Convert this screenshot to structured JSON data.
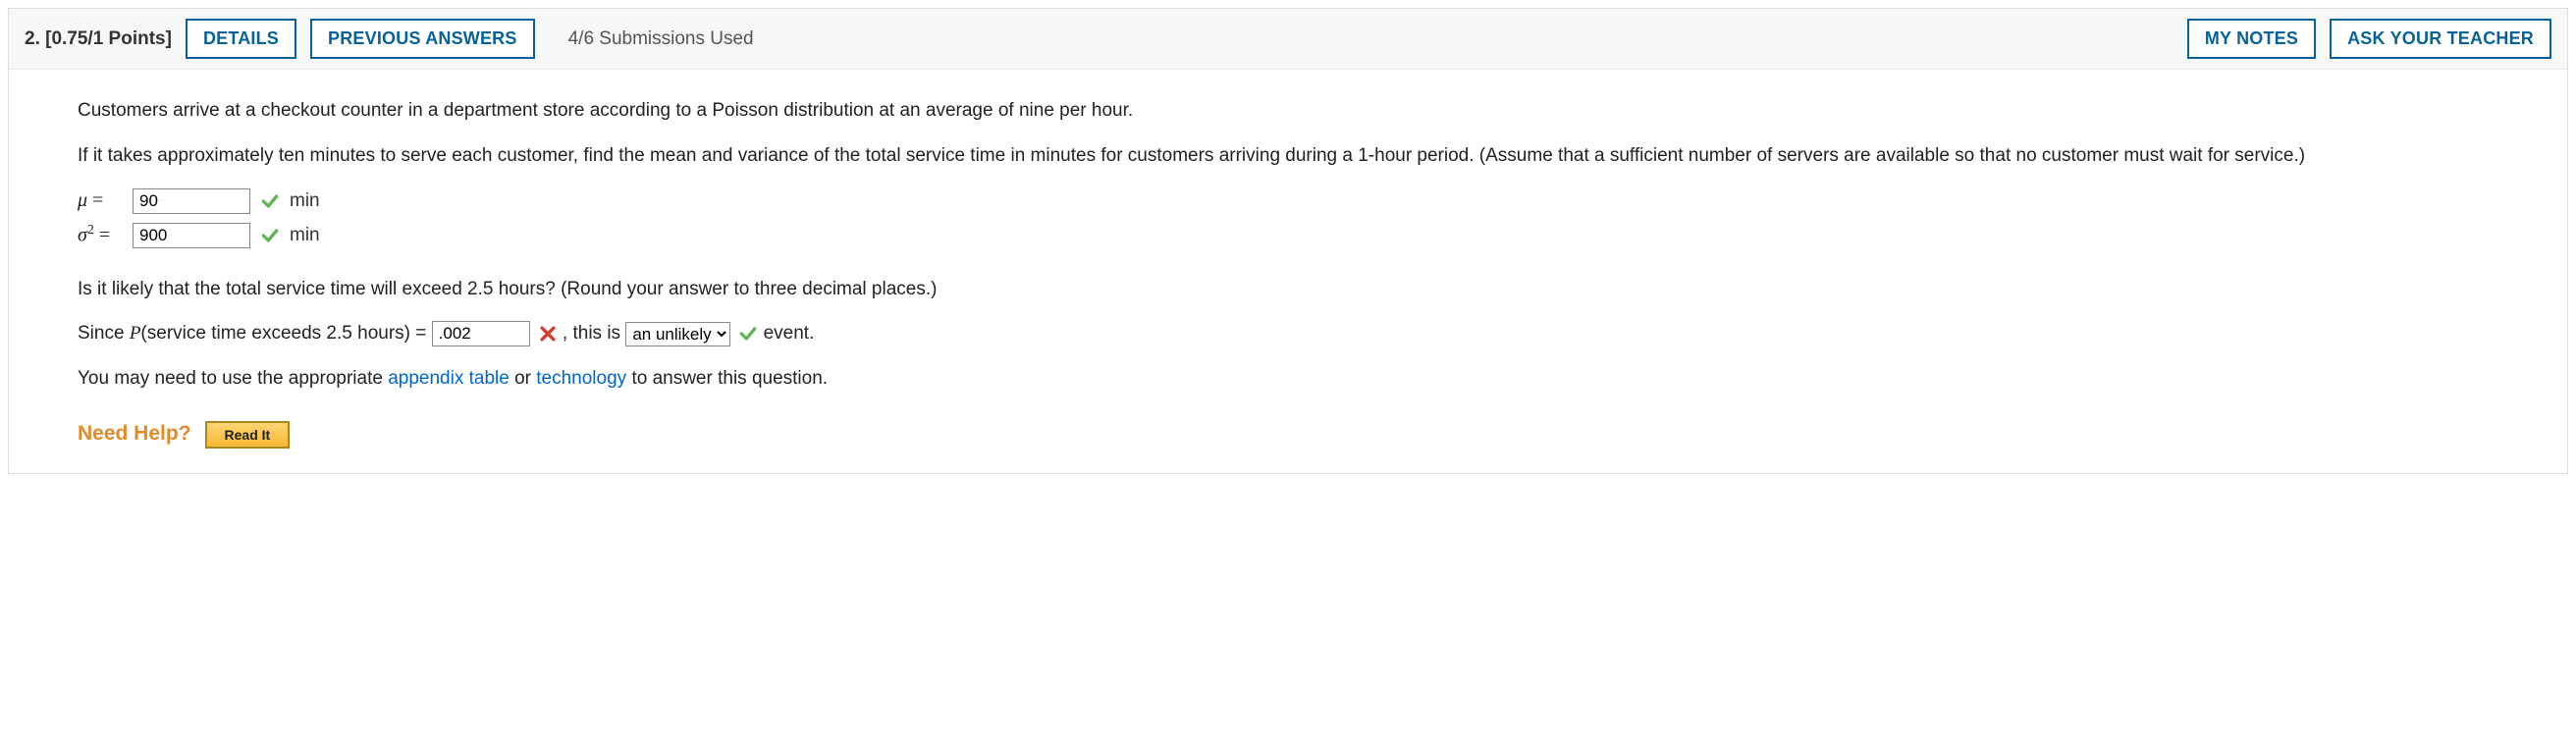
{
  "header": {
    "number_points": "2.  [0.75/1 Points]",
    "details": "DETAILS",
    "previous": "PREVIOUS ANSWERS",
    "subs": "4/6 Submissions Used",
    "my_notes": "MY NOTES",
    "ask_teacher": "ASK YOUR TEACHER"
  },
  "problem": {
    "intro": "Customers arrive at a checkout counter in a department store according to a Poisson distribution at an average of nine per hour.",
    "part1": "If it takes approximately ten minutes to serve each customer, find the mean and variance of the total service time in minutes for customers arriving during a 1-hour period. (Assume that a sufficient number of servers are available so that no customer must wait for service.)",
    "mu_label_prefix": "μ",
    "eq": " = ",
    "mu_value": "90",
    "sigma_label": "σ",
    "sigma_exp": "2",
    "sigma_value": "900",
    "unit_min": "min",
    "part2": "Is it likely that the total service time will exceed 2.5 hours? (Round your answer to three decimal places.)",
    "since_text": "Since P(service time exceeds 2.5 hours) = ",
    "prob_value": ".002",
    "after_prob": ", this is ",
    "dropdown_selected": "an unlikely",
    "event_word": " event.",
    "appendix_pre": "You may need to use the appropriate ",
    "appendix_link": "appendix table",
    "appendix_mid": " or ",
    "technology_link": "technology",
    "appendix_post": " to answer this question."
  },
  "help": {
    "label": "Need Help?",
    "read_it": "Read It"
  },
  "status": {
    "mu": "correct",
    "sigma": "correct",
    "prob": "incorrect",
    "dropdown": "correct"
  }
}
